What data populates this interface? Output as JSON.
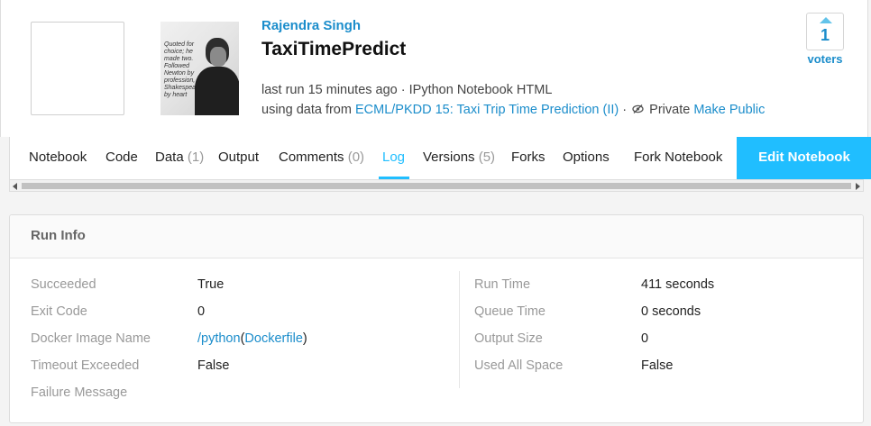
{
  "author": "Rajendra Singh",
  "title": "TaxiTimePredict",
  "avatar_quote": "Quoted for choice; he made two. Followed Newton by profession, Shakespeare by heart",
  "meta": {
    "last_run": "last run 15 minutes ago · IPython Notebook HTML",
    "using_prefix": "using data from",
    "dataset": "ECML/PKDD 15: Taxi Trip Time Prediction (II)",
    "separator": "·",
    "privacy": "Private",
    "make_public": "Make Public"
  },
  "votes": {
    "count": "1",
    "label": "voters"
  },
  "tabs": [
    {
      "label": "Notebook",
      "count": ""
    },
    {
      "label": "Code",
      "count": ""
    },
    {
      "label": "Data",
      "count": "(1)"
    },
    {
      "label": "Output",
      "count": ""
    },
    {
      "label": "Comments",
      "count": "(0)"
    },
    {
      "label": "Log",
      "count": ""
    },
    {
      "label": "Versions",
      "count": "(5)"
    },
    {
      "label": "Forks",
      "count": ""
    },
    {
      "label": "Options",
      "count": ""
    },
    {
      "label": "Fork Notebook",
      "count": ""
    }
  ],
  "active_tab": "Log",
  "edit_button": "Edit Notebook",
  "run_info": {
    "title": "Run Info",
    "left": [
      {
        "label": "Succeeded",
        "value": "True"
      },
      {
        "label": "Exit Code",
        "value": "0"
      },
      {
        "label": "Docker Image Name",
        "value": "/python",
        "value_paren_open": "(",
        "value_link": "Dockerfile",
        "value_paren_close": ")"
      },
      {
        "label": "Timeout Exceeded",
        "value": "False"
      },
      {
        "label": "Failure Message",
        "value": ""
      }
    ],
    "right": [
      {
        "label": "Run Time",
        "value": "411 seconds"
      },
      {
        "label": "Queue Time",
        "value": "0 seconds"
      },
      {
        "label": "Output Size",
        "value": "0"
      },
      {
        "label": "Used All Space",
        "value": "False"
      }
    ]
  },
  "colors": {
    "accent": "#20beff",
    "link": "#1b8dcb"
  },
  "icons": [
    "eye-slash-icon",
    "upvote-arrow-icon",
    "scroll-left-icon",
    "scroll-right-icon"
  ]
}
